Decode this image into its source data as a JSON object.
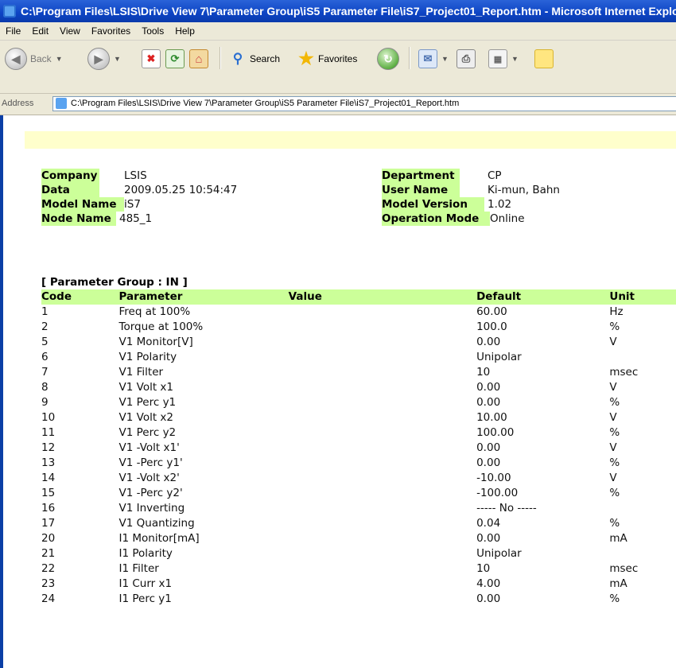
{
  "window": {
    "title": "C:\\Program Files\\LSIS\\Drive View 7\\Parameter Group\\iS5 Parameter File\\iS7_Project01_Report.htm - Microsoft Internet Explorer"
  },
  "menu": [
    "File",
    "Edit",
    "View",
    "Favorites",
    "Tools",
    "Help"
  ],
  "toolbar": {
    "back_label": "Back",
    "search_label": "Search",
    "favorites_label": "Favorites"
  },
  "address": {
    "label": "Address",
    "value": "C:\\Program Files\\LSIS\\Drive View 7\\Parameter Group\\iS5 Parameter File\\iS7_Project01_Report.htm"
  },
  "info_left": [
    {
      "key": "Company",
      "value": "LSIS"
    },
    {
      "key": "Data",
      "value": "2009.05.25  10:54:47"
    },
    {
      "key": "Model Name",
      "value": "iS7"
    },
    {
      "key": "Node Name",
      "value": "485_1"
    }
  ],
  "info_right": [
    {
      "key": "Department",
      "value": "CP"
    },
    {
      "key": "User Name",
      "value": "Ki-mun, Bahn"
    },
    {
      "key": "Model Version",
      "value": "1.02"
    },
    {
      "key": "Operation Mode",
      "value": "Online"
    }
  ],
  "param_group_title": "[ Parameter Group : IN ]",
  "columns": [
    "Code",
    "Parameter",
    "Value",
    "Default",
    "Unit"
  ],
  "rows": [
    {
      "code": "1",
      "parameter": "Freq at 100%",
      "value": "",
      "default": "60.00",
      "unit": "Hz"
    },
    {
      "code": "2",
      "parameter": "Torque at 100%",
      "value": "",
      "default": "100.0",
      "unit": "%"
    },
    {
      "code": "5",
      "parameter": "V1 Monitor[V]",
      "value": "",
      "default": "0.00",
      "unit": "V"
    },
    {
      "code": "6",
      "parameter": "V1 Polarity",
      "value": "",
      "default": "Unipolar",
      "unit": ""
    },
    {
      "code": "7",
      "parameter": "V1 Filter",
      "value": "",
      "default": "10",
      "unit": "msec"
    },
    {
      "code": "8",
      "parameter": "V1 Volt x1",
      "value": "",
      "default": "0.00",
      "unit": "V"
    },
    {
      "code": "9",
      "parameter": "V1 Perc y1",
      "value": "",
      "default": "0.00",
      "unit": "%"
    },
    {
      "code": "10",
      "parameter": "V1 Volt x2",
      "value": "",
      "default": "10.00",
      "unit": "V"
    },
    {
      "code": "11",
      "parameter": "V1 Perc y2",
      "value": "",
      "default": "100.00",
      "unit": "%"
    },
    {
      "code": "12",
      "parameter": "V1 -Volt x1'",
      "value": "",
      "default": "0.00",
      "unit": "V"
    },
    {
      "code": "13",
      "parameter": "V1 -Perc y1'",
      "value": "",
      "default": "0.00",
      "unit": "%"
    },
    {
      "code": "14",
      "parameter": "V1 -Volt x2'",
      "value": "",
      "default": "-10.00",
      "unit": "V"
    },
    {
      "code": "15",
      "parameter": "V1 -Perc y2'",
      "value": "",
      "default": "-100.00",
      "unit": "%"
    },
    {
      "code": "16",
      "parameter": "V1 Inverting",
      "value": "",
      "default": "----- No -----",
      "unit": ""
    },
    {
      "code": "17",
      "parameter": "V1 Quantizing",
      "value": "",
      "default": "0.04",
      "unit": "%"
    },
    {
      "code": "20",
      "parameter": "I1 Monitor[mA]",
      "value": "",
      "default": "0.00",
      "unit": "mA"
    },
    {
      "code": "21",
      "parameter": "I1 Polarity",
      "value": "",
      "default": "Unipolar",
      "unit": ""
    },
    {
      "code": "22",
      "parameter": "I1 Filter",
      "value": "",
      "default": "10",
      "unit": "msec"
    },
    {
      "code": "23",
      "parameter": "I1 Curr x1",
      "value": "",
      "default": "4.00",
      "unit": "mA"
    },
    {
      "code": "24",
      "parameter": "I1 Perc y1",
      "value": "",
      "default": "0.00",
      "unit": "%"
    }
  ]
}
